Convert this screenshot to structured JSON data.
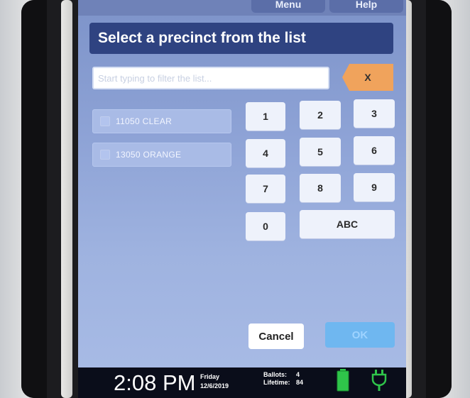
{
  "header": {
    "menu_label": "Menu",
    "help_label": "Help",
    "title": "Select a precinct from the list"
  },
  "filter": {
    "placeholder": "Start typing to filter the list...",
    "value": "",
    "clear_label": "X"
  },
  "precincts": [
    {
      "label": "11050 CLEAR"
    },
    {
      "label": "13050 ORANGE"
    }
  ],
  "keypad": {
    "keys": [
      "1",
      "2",
      "3",
      "4",
      "5",
      "6",
      "7",
      "8",
      "9",
      "0",
      "ABC"
    ]
  },
  "actions": {
    "cancel_label": "Cancel",
    "ok_label": "OK"
  },
  "status": {
    "time": "2:08 PM",
    "day": "Friday",
    "date": "12/6/2019",
    "ballots_label": "Ballots:",
    "ballots_value": "4",
    "lifetime_label": "Lifetime:",
    "lifetime_value": "84",
    "battery_icon": "battery-icon",
    "power_icon": "power-plug-icon"
  },
  "colors": {
    "title_bar": "#2f4381",
    "clear_button": "#f0a35c",
    "ok_button": "#6fb7f0",
    "battery": "#2fc44a"
  }
}
